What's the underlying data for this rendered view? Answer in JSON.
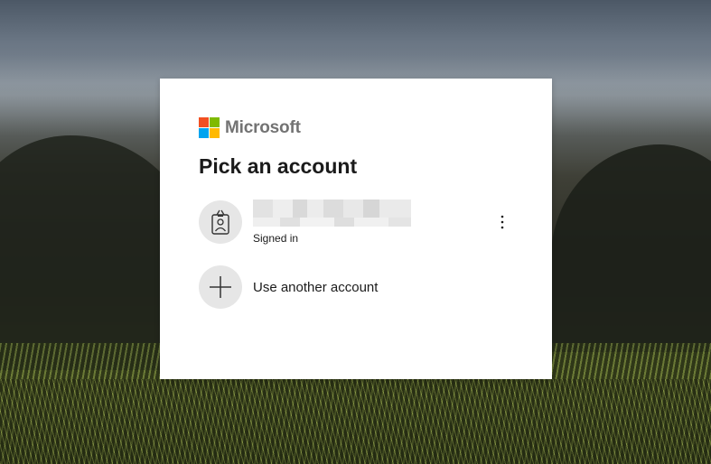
{
  "brand": {
    "name": "Microsoft",
    "colors": [
      "#f25022",
      "#7fba00",
      "#00a4ef",
      "#ffb900"
    ]
  },
  "dialog": {
    "title": "Pick an account"
  },
  "accounts": [
    {
      "status": "Signed in",
      "icon": "badge-person-icon",
      "menu_icon": "more-vertical-icon"
    }
  ],
  "use_another": {
    "label": "Use another account",
    "icon": "plus-icon"
  }
}
